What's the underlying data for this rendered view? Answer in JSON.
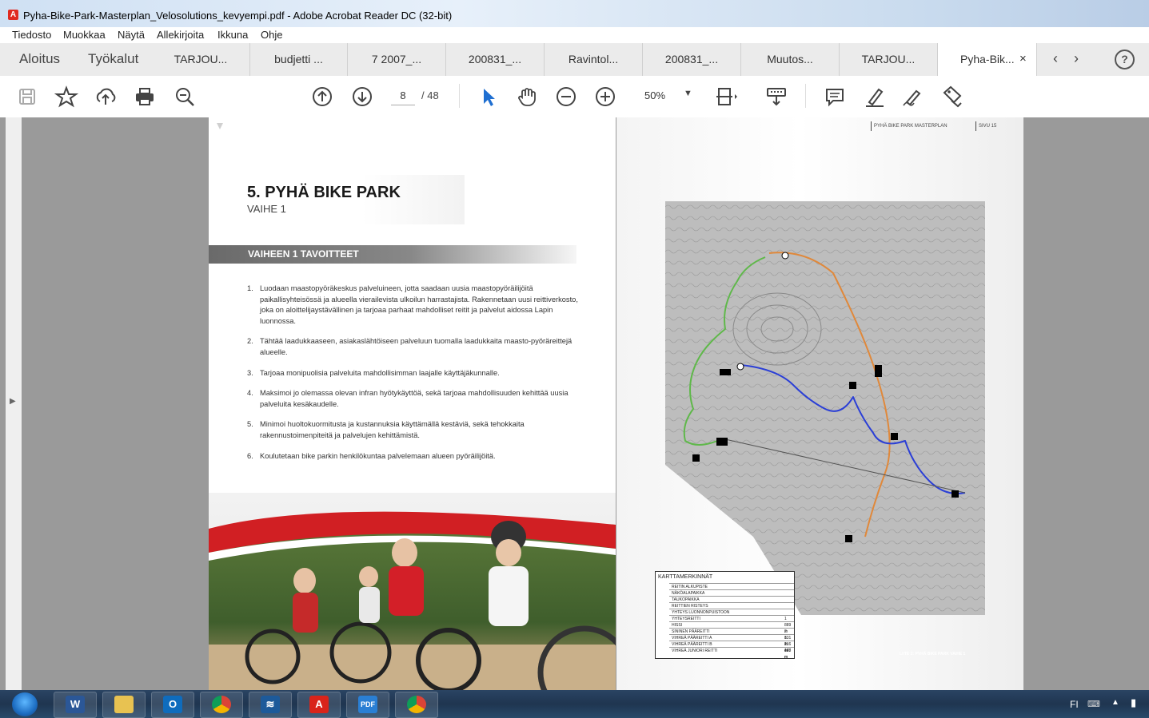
{
  "window": {
    "title": "Pyha-Bike-Park-Masterplan_Velosolutions_kevyempi.pdf - Adobe Acrobat Reader DC (32-bit)",
    "app_icon": "acrobat-icon"
  },
  "menu": [
    "Tiedosto",
    "Muokkaa",
    "Näytä",
    "Allekirjoita",
    "Ikkuna",
    "Ohje"
  ],
  "tabs": {
    "home": "Aloitus",
    "tools": "Työkalut",
    "documents": [
      "TARJOU...",
      "budjetti ...",
      "7 2007_...",
      "200831_...",
      "Ravintol...",
      "200831_...",
      "Muutos...",
      "TARJOU...",
      "Pyha-Bik..."
    ],
    "close": "×",
    "prev": "‹",
    "next": "›",
    "help": "?"
  },
  "toolbar": {
    "page_current": "8",
    "page_total": "/ 48",
    "zoom": "50%"
  },
  "document": {
    "left": {
      "title": "5. PYHÄ BIKE PARK",
      "subtitle": "VAIHE 1",
      "section": "VAIHEEN 1 TAVOITTEET",
      "goals": [
        {
          "num": "1.",
          "text": "Luodaan maastopyöräkeskus palveluineen, jotta saadaan uusia maastopyöräilijöitä paikallisyhteisössä ja alueella vierailevista ulkoilun harrastajista. Rakennetaan uusi reittiverkosto, joka on aloittelijaystävällinen ja tarjoaa parhaat mahdolliset reitit ja palvelut aidossa Lapin luonnossa."
        },
        {
          "num": "2.",
          "text": "Tähtää laadukkaaseen, asiakaslähtöiseen palveluun tuomalla laadukkaita maasto-pyöräreittejä alueelle."
        },
        {
          "num": "3.",
          "text": "Tarjoaa monipuolisia palveluita mahdollisimman laajalle käyttäjäkunnalle."
        },
        {
          "num": "4.",
          "text": "Maksimoi jo olemassa olevan infran hyötykäyttöä, sekä tarjoaa mahdollisuuden kehittää uusia palveluita kesäkaudelle."
        },
        {
          "num": "5.",
          "text": "Minimoi huoltokuormitusta ja kustannuksia käyttämällä kestäviä, sekä tehokkaita rakennustoimenpiteitä ja palvelujen kehittämistä."
        },
        {
          "num": "6.",
          "text": "Koulutetaan bike parkin henkilökuntaa palvelemaan alueen pyöräilijöitä."
        }
      ]
    },
    "right": {
      "header": "PYHÄ BIKE PARK MASTERPLAN",
      "page": "SIVU 15",
      "caption": "LIITE 2: PYHÄ BIKE PARK VAIHE 1",
      "legend": {
        "title": "KARTTAMERKINNÄT",
        "rows": [
          {
            "label": "REITIN ALKUPISTE",
            "value": ""
          },
          {
            "label": "NÄKÖALAPAIKKA",
            "value": ""
          },
          {
            "label": "TAUKOPAIKKA",
            "value": ""
          },
          {
            "label": "REITTIEN RISTEYS",
            "value": ""
          },
          {
            "label": "YHTEYS LUONNONPUISTOON",
            "value": ""
          },
          {
            "label": "YHTEYSREITTI",
            "value": "1 889 m"
          },
          {
            "label": "HISSI",
            "value": ""
          },
          {
            "label": "SININEN PÄÄREITTI",
            "value": "2 831 m"
          },
          {
            "label": "VIHREÄ PÄÄREITTI A",
            "value": "1 216 m"
          },
          {
            "label": "VIHREÄ PÄÄREITTI B",
            "value": "1 447 m"
          },
          {
            "label": "VIHREÄ JUNIORI REITTI",
            "value": "135 m"
          }
        ]
      }
    }
  },
  "taskbar": {
    "apps": [
      "word-icon",
      "file-explorer-icon",
      "outlook-icon",
      "chrome-icon",
      "wifi-icon",
      "acrobat-icon",
      "pdf-icon",
      "chrome-icon"
    ],
    "word_glyph": "W",
    "outlook_glyph": "O",
    "acrobat_glyph": "A",
    "pdf_glyph": "PDF",
    "lang": "FI"
  },
  "colors": {
    "accent_red": "#d7191c",
    "blue_trail": "#2b3fd6",
    "green_trail": "#5fb84a",
    "orange_trail": "#e0883a"
  }
}
